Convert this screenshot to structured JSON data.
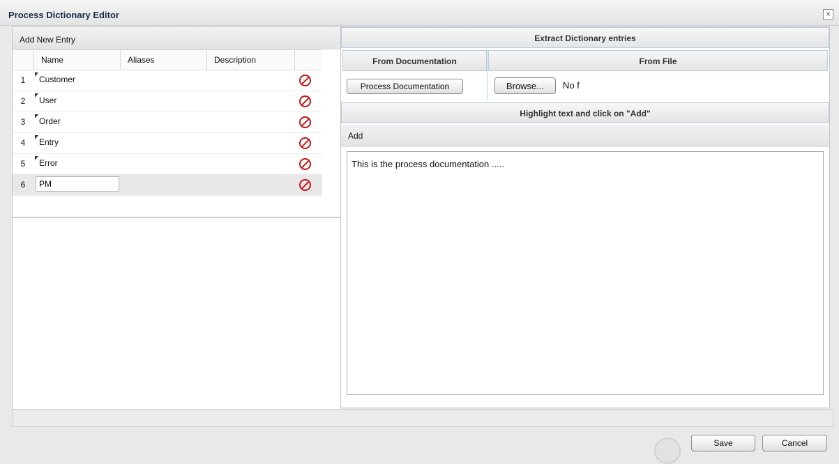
{
  "dialog": {
    "title": "Process Dictionary Editor",
    "close_glyph": "×"
  },
  "left": {
    "add_entry": "Add New Entry",
    "columns": [
      "Name",
      "Aliases",
      "Description"
    ],
    "rows": [
      {
        "num": "1",
        "name": "Customer"
      },
      {
        "num": "2",
        "name": "User"
      },
      {
        "num": "3",
        "name": "Order"
      },
      {
        "num": "4",
        "name": "Entry"
      },
      {
        "num": "5",
        "name": "Error"
      },
      {
        "num": "6",
        "name": "PM"
      }
    ]
  },
  "right": {
    "extract_title": "Extract Dictionary entries",
    "from_doc_title": "From Documentation",
    "from_file_title": "From File",
    "process_doc_button": "Process Documentation",
    "browse_button": "Browse...",
    "no_file_text": "No f",
    "highlight_title": "Highlight text and click on \"Add\"",
    "add_label": "Add",
    "doc_text": "This is the process documentation ....."
  },
  "footer": {
    "save": "Save",
    "cancel": "Cancel"
  },
  "colors": {
    "accent_border": "#b8cbe0",
    "delete_red": "#c01818"
  },
  "icons": [
    "close-icon",
    "delete-icon"
  ]
}
